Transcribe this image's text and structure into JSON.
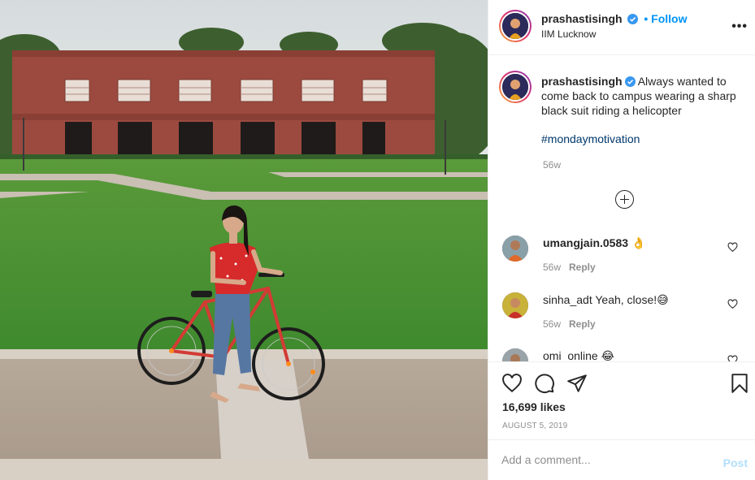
{
  "post": {
    "author": "prashastisingh",
    "follow_label": "Follow",
    "bullet": "•",
    "location": "IIM Lucknow",
    "more_icon": "more-options-icon",
    "caption_text": "Always wanted to come back to campus wearing a sharp black suit riding a helicopter",
    "hashtag": "#mondaymotivation",
    "caption_age": "56w"
  },
  "comments": [
    {
      "user": "umangjain.0583",
      "text": "👌",
      "age": "56w",
      "reply_label": "Reply"
    },
    {
      "user": "sinha_adt",
      "text": "Yeah, close!😅",
      "age": "56w",
      "reply_label": "Reply"
    },
    {
      "user": "omi_online",
      "text": "😂",
      "age": "",
      "reply_label": ""
    }
  ],
  "actions": {
    "like_icon": "heart-icon",
    "comment_icon": "comment-bubble-icon",
    "share_icon": "paper-plane-icon",
    "save_icon": "bookmark-icon",
    "likes_text": "16,699 likes",
    "date": "AUGUST 5, 2019"
  },
  "add_comment": {
    "placeholder": "Add a comment...",
    "post_label": "Post"
  },
  "colors": {
    "link_blue": "#0095f6",
    "hashtag": "#00376b",
    "muted": "#8e8e8e",
    "post_disabled": "#b2dffc",
    "building_brick": "#9c4a3f",
    "lawn": "#4f8f34"
  }
}
